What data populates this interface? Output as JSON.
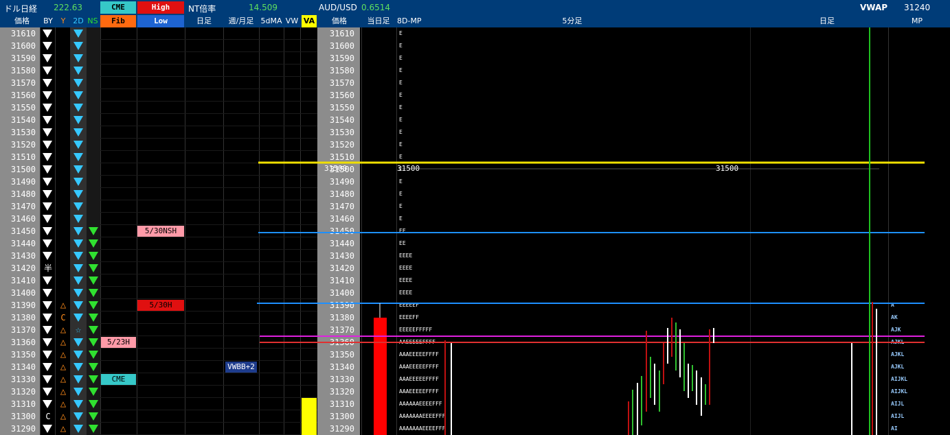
{
  "topbar": {
    "dollar_nikkei_label": "ドル日経",
    "dollar_nikkei_value": "222.63",
    "cme_button": "CME",
    "high_button": "High",
    "nt_label": "NT倍率",
    "nt_value": "14.509",
    "audusd_label": "AUD/USD",
    "audusd_value": "0.6514",
    "vwap_label": "VWAP",
    "vwap_value": "31240"
  },
  "subbar": {
    "price_label": "価格",
    "by_label": "BY",
    "y_label": "Y",
    "d2_label": "2D",
    "ns_label": "NS",
    "fib_button": "Fib",
    "low_button": "Low",
    "daily_label": "日足",
    "weekly_monthly_label": "週/月足",
    "ma5_label": "5dMA",
    "vw_label": "VW",
    "va_label": "VA",
    "price_label2": "価格",
    "today_label": "当日足",
    "mp8d_label": "8D-MP",
    "min5_label": "5分足",
    "daily2_label": "日足",
    "mp_label": "MP"
  },
  "prices": [
    "31610",
    "31600",
    "31590",
    "31580",
    "31570",
    "31560",
    "31550",
    "31540",
    "31530",
    "31520",
    "31510",
    "31500",
    "31490",
    "31480",
    "31470",
    "31460",
    "31450",
    "31440",
    "31430",
    "31420",
    "31410",
    "31400",
    "31390",
    "31380",
    "31370",
    "31360",
    "31350",
    "31340",
    "31330",
    "31320",
    "31310",
    "31300",
    "31290"
  ],
  "by_marks": [
    "▼",
    "▼",
    "▼",
    "▼",
    "▼",
    "▼",
    "▼",
    "▼",
    "▼",
    "▼",
    "▼",
    "▼",
    "▼",
    "▼",
    "▼",
    "▼",
    "▼",
    "▼",
    "▼",
    "半",
    "▼",
    "▼",
    "▼",
    "▼",
    "▼",
    "▼",
    "▼",
    "▼",
    "▼",
    "▼",
    "▼",
    "C",
    "▼"
  ],
  "y_marks": [
    "",
    "",
    "",
    "",
    "",
    "",
    "",
    "",
    "",
    "",
    "",
    "",
    "",
    "",
    "",
    "",
    "",
    "",
    "",
    "",
    "",
    "",
    "△",
    "C",
    "△",
    "△",
    "△",
    "△",
    "△",
    "△",
    "△",
    "△",
    "△"
  ],
  "tags": {
    "nsh": "5/30NSH",
    "h530": "5/30H",
    "h523": "5/23H",
    "cme": "CME",
    "vwbb": "VWBB+2"
  },
  "mp8d": [
    "E",
    "E",
    "E",
    "E",
    "E",
    "E",
    "E",
    "E",
    "E",
    "E",
    "E",
    "E",
    "E",
    "E",
    "E",
    "E",
    "EE",
    "EE",
    "EEEE",
    "EEEE",
    "EEEE",
    "EEEE",
    "EEEEEF",
    "EEEEFF",
    "EEEEEFFFFF",
    "AAEEEEEFFFF",
    "AAAEEEEEFFFF",
    "AAAEEEEEFFFF",
    "AAAEEEEEFFFF",
    "AAAEEEEEFFFF",
    "AAAAAAEEEEFFF",
    "AAAAAAAEEEEFFF",
    "AAAAAAAEEEEFFF"
  ],
  "mp_right": [
    "",
    "",
    "",
    "",
    "",
    "",
    "",
    "",
    "",
    "",
    "",
    "",
    "",
    "",
    "",
    "",
    "",
    "",
    "",
    "",
    "",
    "",
    "A",
    "AK",
    "AJK",
    "AJKL",
    "AJKL",
    "AJKL",
    "AIJKL",
    "AIJKL",
    "AIJL",
    "AIJL",
    "AI"
  ],
  "level_labels": {
    "l31500a": "31500",
    "l31500b": "31500",
    "l31500c": "31500"
  },
  "colors": {
    "yellow_line": "#f0e000",
    "blue_line": "#1e90ff",
    "magenta_line": "#e020e0",
    "red_line": "#e03030",
    "green_vline": "#20c020"
  }
}
